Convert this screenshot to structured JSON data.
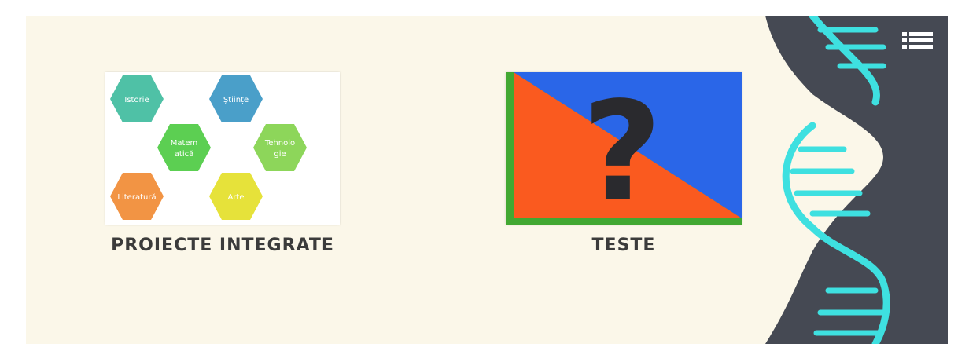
{
  "tiles": [
    {
      "label": "PROIECTE INTEGRATE",
      "subjects": [
        {
          "name": "Istorie",
          "color": "#4fc1a6"
        },
        {
          "name": "Științe",
          "color": "#4a9fc9"
        },
        {
          "name": "Matem",
          "name2": "atică",
          "color": "#5ccf52"
        },
        {
          "name": "Tehnolo",
          "name2": "gie",
          "color": "#8dd65a"
        },
        {
          "name": "Literatură",
          "color": "#f29444"
        },
        {
          "name": "Arte",
          "color": "#e6e23a"
        }
      ]
    },
    {
      "label": "TESTE",
      "symbol": "?"
    }
  ],
  "colors": {
    "background": "#fbf7e9",
    "strip": "#454953",
    "dna": "#3ee0e0",
    "teste_orange": "#fa5a1f",
    "teste_blue": "#2a66e8",
    "teste_green": "#42a832"
  },
  "menu_icon": "list-icon"
}
